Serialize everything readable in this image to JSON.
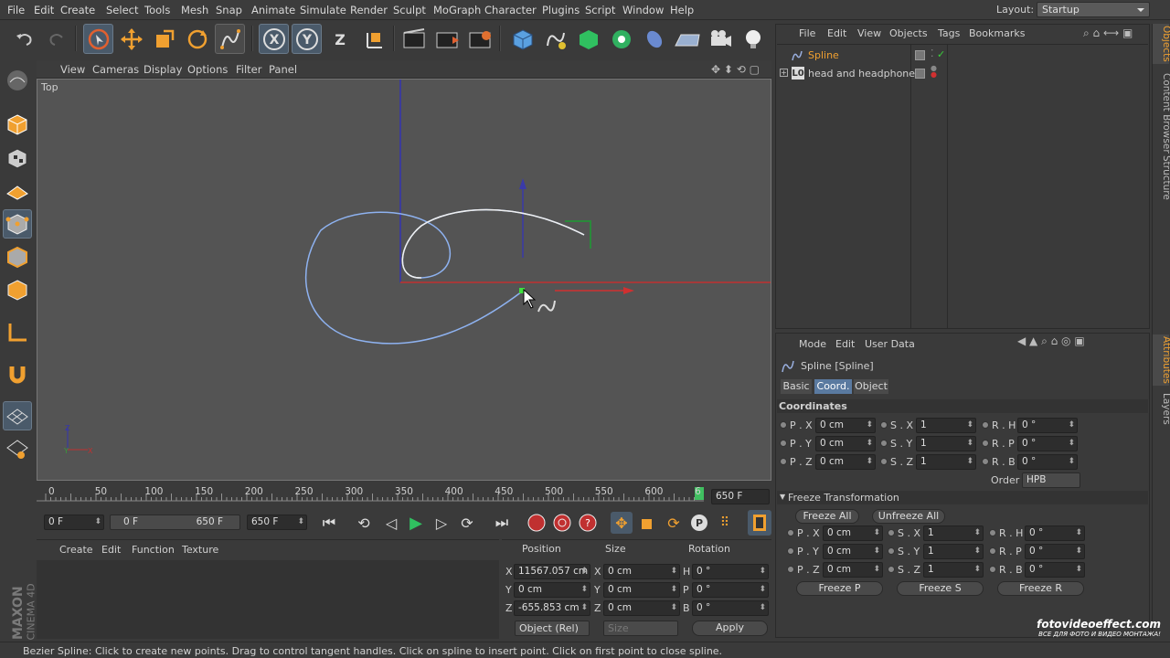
{
  "menu": [
    "File",
    "Edit",
    "Create",
    "Select",
    "Tools",
    "Mesh",
    "Snap",
    "Animate",
    "Simulate",
    "Render",
    "Sculpt",
    "MoGraph",
    "Character",
    "Plugins",
    "Script",
    "Window",
    "Help"
  ],
  "layout": {
    "label": "Layout:",
    "value": "Startup"
  },
  "viewport": {
    "menu": [
      "View",
      "Cameras",
      "Display",
      "Options",
      "Filter",
      "Panel"
    ],
    "view_name": "Top"
  },
  "timeline": {
    "ticks": [
      "0",
      "50",
      "100",
      "150",
      "200",
      "250",
      "300",
      "350",
      "400",
      "450",
      "500",
      "550",
      "600",
      "6"
    ],
    "end_frame": "650 F"
  },
  "playbar": {
    "current": "0 F",
    "range_start": "0 F",
    "range_end": "650 F",
    "max": "650 F"
  },
  "material_menu": [
    "Create",
    "Edit",
    "Function",
    "Texture"
  ],
  "coords": {
    "headers": [
      "Position",
      "Size",
      "Rotation"
    ],
    "rows": [
      {
        "axis": "X",
        "pos": "11567.057 cm",
        "saxis": "X",
        "size": "0 cm",
        "raxis": "H",
        "rot": "0 °"
      },
      {
        "axis": "Y",
        "pos": "0 cm",
        "saxis": "Y",
        "size": "0 cm",
        "raxis": "P",
        "rot": "0 °"
      },
      {
        "axis": "Z",
        "pos": "-655.853 cm",
        "saxis": "Z",
        "size": "0 cm",
        "raxis": "B",
        "rot": "0 °"
      }
    ],
    "mode": "Object (Rel)",
    "size_mode": "Size",
    "apply": "Apply"
  },
  "objects": {
    "menu": [
      "File",
      "Edit",
      "View",
      "Objects",
      "Tags",
      "Bookmarks"
    ],
    "items": [
      {
        "name": "Spline",
        "selected": true
      },
      {
        "name": "head and headphones",
        "selected": false
      }
    ]
  },
  "side_tabs_top": [
    "Objects",
    "Content Browser",
    "Structure"
  ],
  "side_tabs_bottom": [
    "Attributes",
    "Layers"
  ],
  "attributes": {
    "menu": [
      "Mode",
      "Edit",
      "User Data"
    ],
    "title": "Spline [Spline]",
    "tabs": [
      "Basic",
      "Coord.",
      "Object"
    ],
    "active_tab": "Coord.",
    "section": "Coordinates",
    "grid": [
      [
        {
          "l": "P . X",
          "v": "0 cm"
        },
        {
          "l": "S . X",
          "v": "1"
        },
        {
          "l": "R . H",
          "v": "0 °"
        }
      ],
      [
        {
          "l": "P . Y",
          "v": "0 cm"
        },
        {
          "l": "S . Y",
          "v": "1"
        },
        {
          "l": "R . P",
          "v": "0 °"
        }
      ],
      [
        {
          "l": "P . Z",
          "v": "0 cm"
        },
        {
          "l": "S . Z",
          "v": "1"
        },
        {
          "l": "R . B",
          "v": "0 °"
        }
      ]
    ],
    "order_label": "Order",
    "order_value": "HPB",
    "freeze_section": "Freeze Transformation",
    "freeze_all": "Freeze All",
    "unfreeze_all": "Unfreeze All",
    "freeze_grid": [
      [
        {
          "l": "P . X",
          "v": "0 cm"
        },
        {
          "l": "S . X",
          "v": "1"
        },
        {
          "l": "R . H",
          "v": "0 °"
        }
      ],
      [
        {
          "l": "P . Y",
          "v": "0 cm"
        },
        {
          "l": "S . Y",
          "v": "1"
        },
        {
          "l": "R . P",
          "v": "0 °"
        }
      ],
      [
        {
          "l": "P . Z",
          "v": "0 cm"
        },
        {
          "l": "S . Z",
          "v": "1"
        },
        {
          "l": "R . B",
          "v": "0 °"
        }
      ]
    ],
    "freeze_p": "Freeze P",
    "freeze_s": "Freeze S",
    "freeze_r": "Freeze R"
  },
  "status": "Bezier Spline: Click to create new points. Drag to control tangent handles. Click on spline to insert point. Click on first point to close spline.",
  "brand": {
    "line1": "MAXON",
    "line2": "CINEMA 4D"
  },
  "watermark": {
    "line1": "fotovideoeffect.com",
    "line2": "ВСЕ ДЛЯ ФОТО И ВИДЕО МОНТАЖА!"
  },
  "colors": {
    "accent": "#f0a030",
    "selected": "#f0a030",
    "axis_x": "#d03030",
    "axis_y": "#3030c0",
    "spline": "#8eb2f0"
  }
}
